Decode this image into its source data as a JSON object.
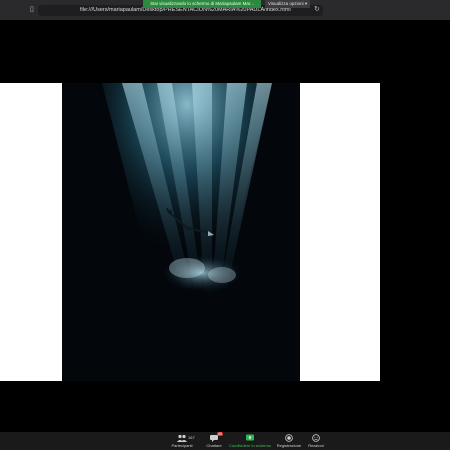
{
  "browser": {
    "url": "file:///Users/mariapaulam/Desktop/PRESENTACION%20MARIA%20PAULA/index.html"
  },
  "share_banner": {
    "text": "Stai visualizzando lo schermo di Mariapaulam Mar...",
    "options_label": "Visualizza opzioni"
  },
  "toolbar": {
    "participants": {
      "label": "Partecipanti",
      "count": "167"
    },
    "chat": {
      "label": "Chattare",
      "badge": "60"
    },
    "share": {
      "label": "Condividere lo schermo"
    },
    "record": {
      "label": "Registrazione"
    },
    "reactions": {
      "label": "Reazioni"
    }
  },
  "colors": {
    "share_green": "#2c8a3f",
    "toolbar_bg": "#1a1a1a",
    "badge_red": "#e0312f"
  }
}
